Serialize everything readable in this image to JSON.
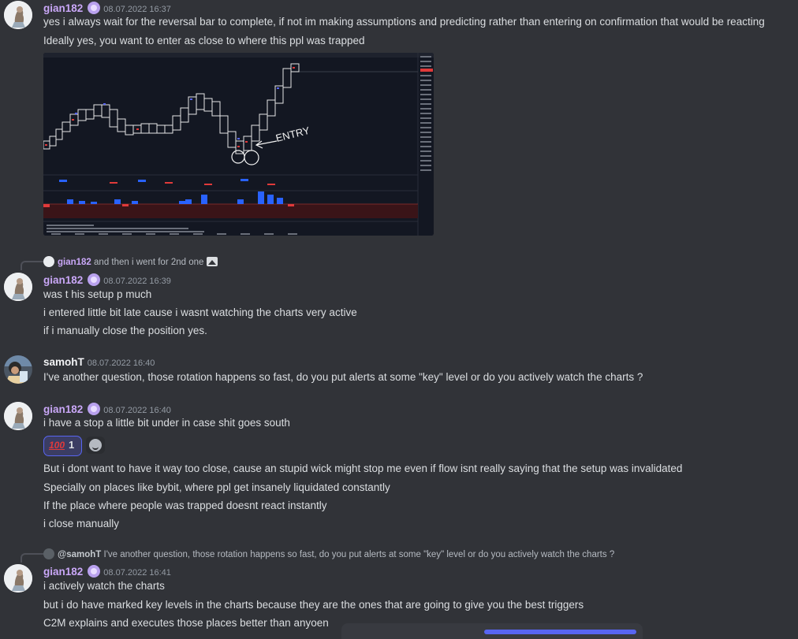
{
  "messages": {
    "m1": {
      "author": "gian182",
      "timestamp": "08.07.2022 16:37",
      "lines": [
        "yes i always wait for the reversal bar to complete, if not im making assumptions and predicting rather than entering on confirmation that would be reacting",
        "Ideally yes, you want to enter as close to where this ppl was trapped"
      ],
      "attachment": {
        "annotation": "ENTRY"
      }
    },
    "m2": {
      "reply_to": {
        "author": "gian182",
        "text": "and then i went for 2nd one"
      },
      "author": "gian182",
      "timestamp": "08.07.2022 16:39",
      "lines": [
        "was t his setup p much",
        "i entered little bit late cause i wasnt watching the charts very active",
        "if i manually close the position yes."
      ]
    },
    "m3": {
      "author": "samohT",
      "timestamp": "08.07.2022 16:40",
      "lines": [
        "I've another question, those rotation happens so fast, do you put alerts at some \"key\" level or do you actively watch the charts ?"
      ]
    },
    "m4": {
      "author": "gian182",
      "timestamp": "08.07.2022 16:40",
      "lines": [
        "i have a stop a little bit under in case shit goes south"
      ],
      "reaction": {
        "emoji": "100",
        "count": "1"
      },
      "more_lines": [
        "But i dont want to have it way too close, cause an stupid wick might stop me even if flow isnt really saying that the setup was invalidated",
        "Specially on places like bybit, where ppl get insanely liquidated constantly",
        "If the place where people was trapped doesnt react instantly",
        "i close manually"
      ]
    },
    "m5": {
      "reply_to": {
        "author": "@samohT",
        "text": "I've another question, those rotation happens so fast, do you put alerts at some \"key\" level or do you actively watch the charts ?"
      },
      "author": "gian182",
      "timestamp": "08.07.2022 16:41",
      "lines": [
        "i actively watch the charts",
        "but i do have marked key levels in the charts because they are the ones that are going to give you the best triggers",
        "C2M explains and executes those places better than anyoen"
      ]
    }
  },
  "colors": {
    "background": "#313338",
    "username": "#c9a7f7",
    "reaction_accent": "#5865f2"
  }
}
